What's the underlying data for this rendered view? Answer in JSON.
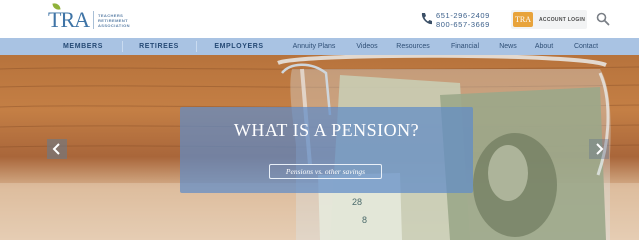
{
  "logo": {
    "mark": "TRA",
    "text_lines": [
      "TEACHERS",
      "RETIREMENT",
      "ASSOCIATION"
    ]
  },
  "contact": {
    "phone_1": "651-296-2409",
    "phone_2": "800-657-3669"
  },
  "account": {
    "badge": "TRA",
    "label": "ACCOUNT LOGIN"
  },
  "nav": {
    "primary": [
      "MEMBERS",
      "RETIREES",
      "EMPLOYERS"
    ],
    "secondary": [
      "Annuity Plans",
      "Videos",
      "Resources",
      "Financial",
      "News",
      "About",
      "Contact"
    ]
  },
  "hero": {
    "title": "WHAT IS A PENSION?",
    "button_label": "Pensions vs. other savings",
    "bill_text": [
      "28",
      "8"
    ]
  },
  "colors": {
    "brand_blue": "#3f74a6",
    "nav_bg": "#a9c3e3",
    "accent_orange": "#e8a33b"
  },
  "icons": [
    "phone-icon",
    "search-icon",
    "chevron-left-icon",
    "chevron-right-icon"
  ]
}
